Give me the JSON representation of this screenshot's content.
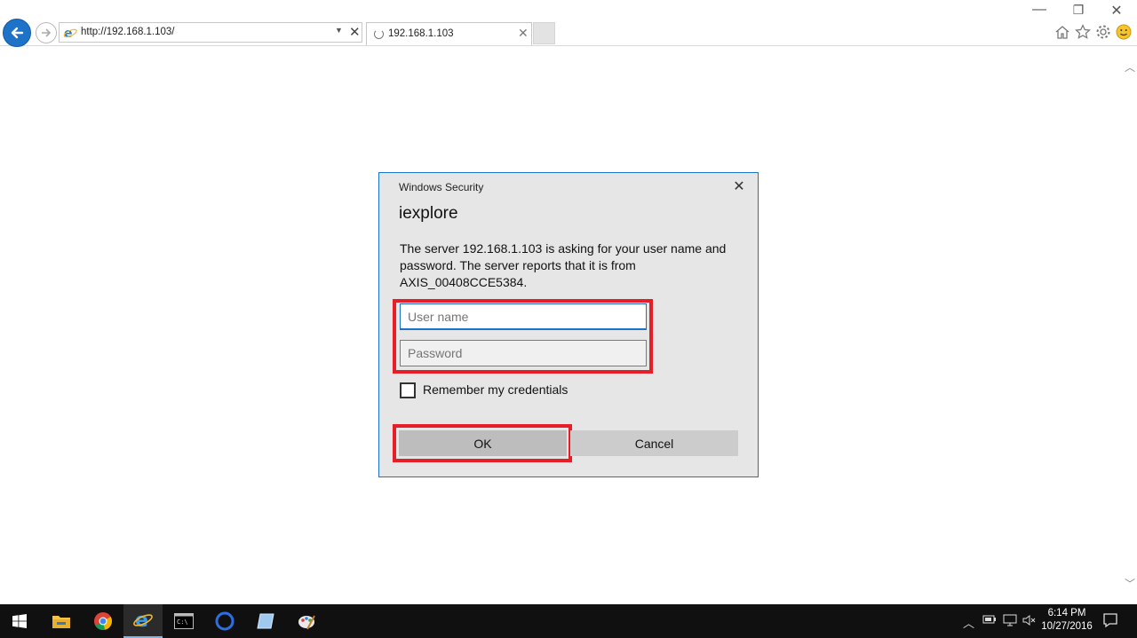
{
  "browser": {
    "address_url": "http://192.168.1.103/",
    "tab_title": "192.168.1.103"
  },
  "dialog": {
    "title": "Windows Security",
    "app_name": "iexplore",
    "message": "The server 192.168.1.103 is asking for your user name and password. The server reports that it is from AXIS_00408CCE5384.",
    "username_placeholder": "User name",
    "password_placeholder": "Password",
    "remember_label": "Remember my credentials",
    "ok_label": "OK",
    "cancel_label": "Cancel"
  },
  "taskbar": {
    "time": "6:14 PM",
    "date": "10/27/2016"
  },
  "colors": {
    "highlight": "#e51e27",
    "accent": "#1a73c8"
  }
}
